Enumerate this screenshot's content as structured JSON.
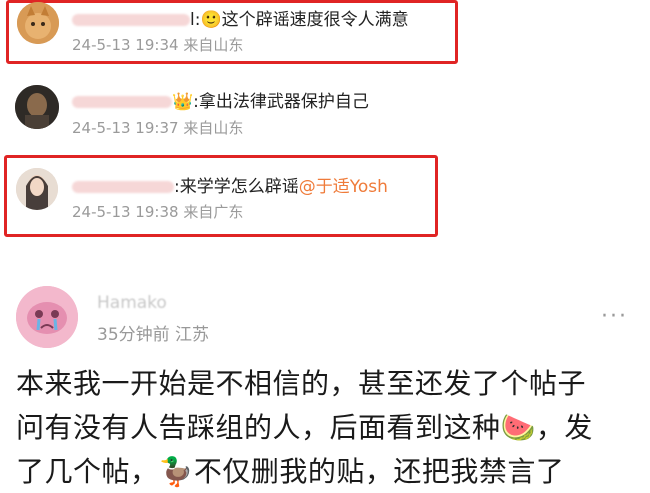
{
  "comments": [
    {
      "text": "这个辟谣速度很令人满意",
      "time": "24-5-13 19:34",
      "location": "来自山东",
      "highlighted": true
    },
    {
      "text": ":拿出法律武器保护自己",
      "time": "24-5-13 19:37",
      "location": "来自山东",
      "highlighted": false
    },
    {
      "text": ":来学学怎么辟谣",
      "mention": "@于适Yosh",
      "time": "24-5-13 19:38",
      "location": "来自广东",
      "highlighted": true
    }
  ],
  "post": {
    "author": "Hamako",
    "time": "35分钟前",
    "location": "江苏",
    "more_icon": "···",
    "lines": [
      "本来我一开始是不相信的，甚至还发了个帖子",
      "问有没有人告踩组的人，后面看到这种",
      "，发",
      "了几个帖，",
      "不仅删我的贴，还把我禁言了"
    ]
  },
  "colors": {
    "highlight_border": "#e02424",
    "mention": "#ef7b3a",
    "meta": "#9a9a9a"
  }
}
